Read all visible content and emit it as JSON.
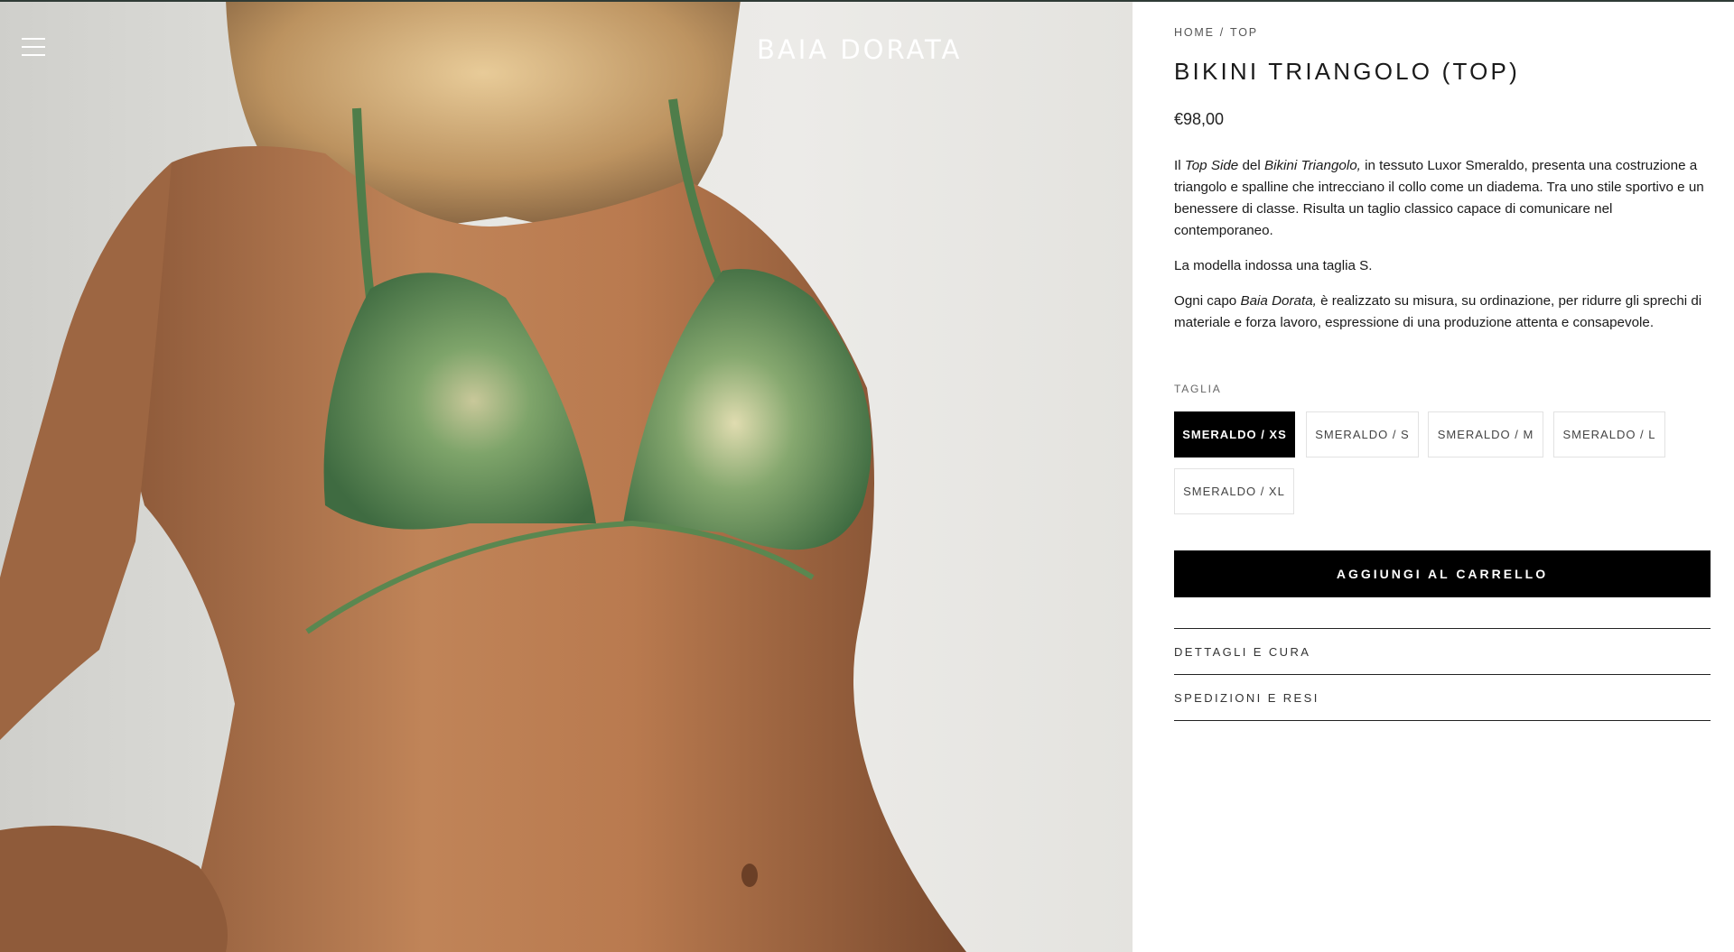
{
  "header": {
    "logo": "BAIA DORATA",
    "menu_icon": "hamburger-menu-icon"
  },
  "breadcrumb": {
    "home": "HOME",
    "separator": "/",
    "current": "TOP"
  },
  "product": {
    "title": "BIKINI TRIANGOLO (TOP)",
    "price": "€98,00",
    "description": {
      "p1_a": "Il ",
      "p1_b": "Top Side",
      "p1_c": " del ",
      "p1_d": "Bikini Triangolo,",
      "p1_e": " in tessuto Luxor Smeraldo, presenta una costruzione a triangolo e spalline che intrecciano il collo come un diadema. Tra uno stile sportivo e un benessere di classe. Risulta un taglio classico capace di comunicare nel contemporaneo.",
      "p2": "La modella indossa una taglia S.",
      "p3_a": "Ogni capo ",
      "p3_b": "Baia Dorata,",
      "p3_c": " è realizzato su misura, su ordinazione, per ridurre gli sprechi di materiale e forza lavoro, espressione di una produzione attenta e consapevole."
    }
  },
  "size_selector": {
    "label": "TAGLIA",
    "options": [
      "SMERALDO / XS",
      "SMERALDO / S",
      "SMERALDO / M",
      "SMERALDO / L",
      "SMERALDO / XL"
    ],
    "selected": "SMERALDO / XS"
  },
  "cart": {
    "add_label": "AGGIUNGI AL CARRELLO"
  },
  "accordion": {
    "items": [
      "DETTAGLI E CURA",
      "SPEDIZIONI E RESI"
    ]
  },
  "colors": {
    "accent": "#000000",
    "fabric": "#5f8a55",
    "skin": "#b97a4f",
    "background": "#e8e7e3"
  }
}
